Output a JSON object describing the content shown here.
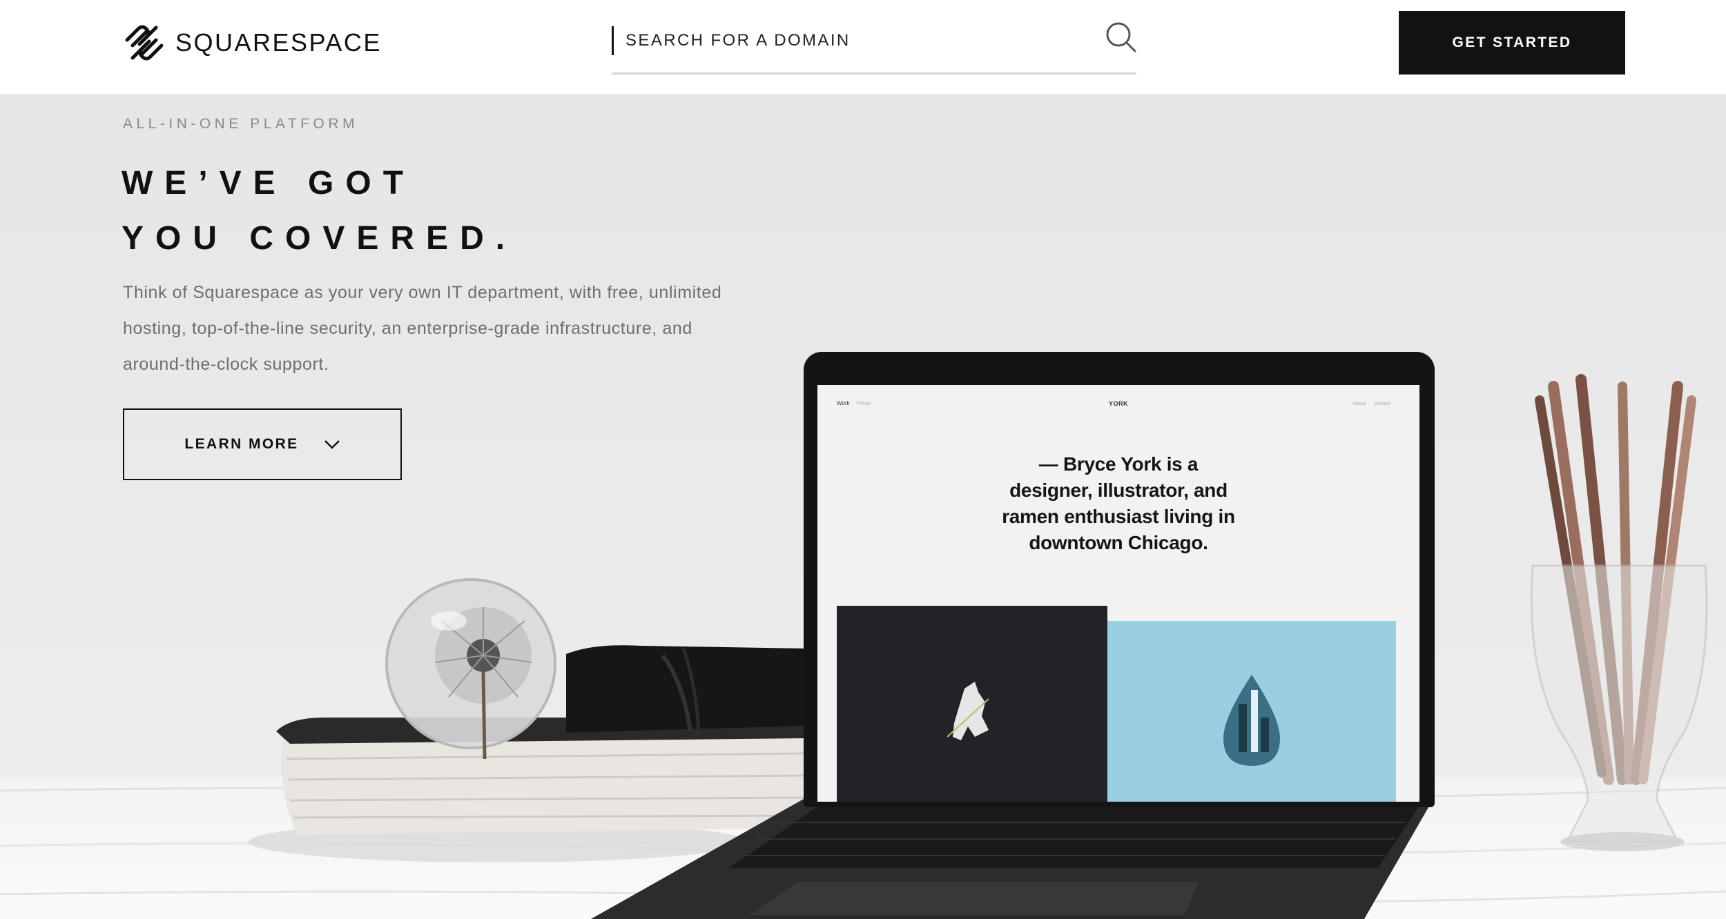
{
  "header": {
    "brand": "SQUARESPACE",
    "search": {
      "placeholder": "SEARCH FOR A DOMAIN"
    },
    "cta_label": "GET STARTED"
  },
  "hero": {
    "eyebrow": "ALL-IN-ONE PLATFORM",
    "headline": [
      "WE’VE GOT",
      "YOU COVERED."
    ],
    "body": "Think of Squarespace as your very own IT department, with free, unlimited hosting, top-of-the-line security, an enterprise-grade infrastructure, and around-the-clock support.",
    "learn_more_label": "LEARN MORE"
  },
  "laptop_site": {
    "nav_left": [
      "Work",
      "Press"
    ],
    "title": "YORK",
    "nav_right": [
      "About",
      "Contact"
    ],
    "bio": [
      "— Bryce York is a",
      "designer, illustrator, and",
      "ramen enthusiast living in",
      "downtown Chicago."
    ]
  },
  "colors": {
    "header_bg": "#ffffff",
    "cta_bg": "#121212",
    "hero_bg": "#ececec",
    "tile_dark": "#222328",
    "tile_blue": "#9acfe1"
  },
  "icons": [
    "squarespace-logo-icon",
    "search-icon",
    "chevron-down-icon"
  ]
}
